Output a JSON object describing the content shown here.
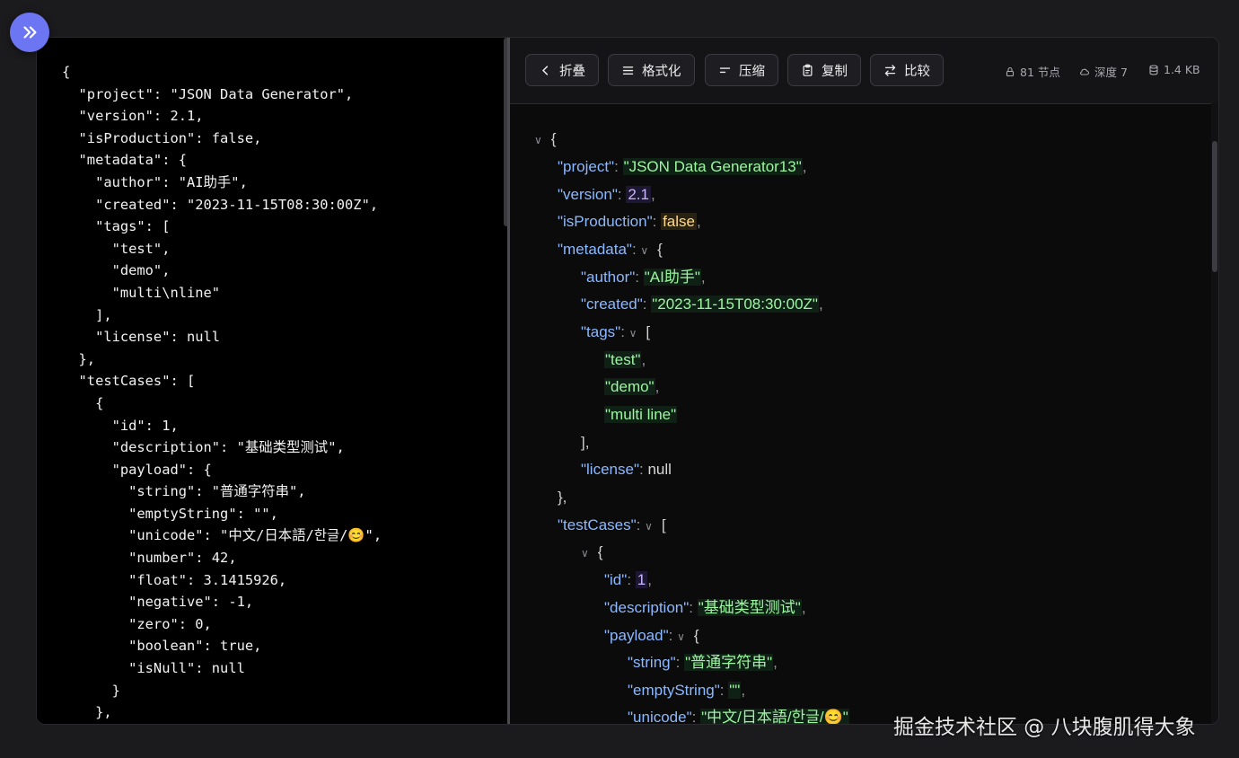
{
  "toolbar": {
    "collapse_label": "折叠",
    "format_label": "格式化",
    "compress_label": "压缩",
    "copy_label": "复制",
    "compare_label": "比较"
  },
  "stats": {
    "nodes": "81 节点",
    "depth": "深度 7",
    "size": "1.4 KB"
  },
  "raw_json": "{\n  \"project\": \"JSON Data Generator\",\n  \"version\": 2.1,\n  \"isProduction\": false,\n  \"metadata\": {\n    \"author\": \"AI助手\",\n    \"created\": \"2023-11-15T08:30:00Z\",\n    \"tags\": [\n      \"test\",\n      \"demo\",\n      \"multi\\nline\"\n    ],\n    \"license\": null\n  },\n  \"testCases\": [\n    {\n      \"id\": 1,\n      \"description\": \"基础类型测试\",\n      \"payload\": {\n        \"string\": \"普通字符串\",\n        \"emptyString\": \"\",\n        \"unicode\": \"中文/日本語/한글/😊\",\n        \"number\": 42,\n        \"float\": 3.1415926,\n        \"negative\": -1,\n        \"zero\": 0,\n        \"boolean\": true,\n        \"isNull\": null\n      }\n    },",
  "tree": {
    "open_brace": "{",
    "project_key": "\"project\"",
    "project_val": "\"JSON Data Generator13\"",
    "version_key": "\"version\"",
    "version_val": "2.1",
    "isProduction_key": "\"isProduction\"",
    "isProduction_val": "false",
    "metadata_key": "\"metadata\"",
    "author_key": "\"author\"",
    "author_val": "\"AI助手\"",
    "created_key": "\"created\"",
    "created_val": "\"2023-11-15T08:30:00Z\"",
    "tags_key": "\"tags\"",
    "tag_test": "\"test\"",
    "tag_demo": "\"demo\"",
    "tag_multi": "\"multi line\"",
    "license_key": "\"license\"",
    "license_val": "null",
    "testCases_key": "\"testCases\"",
    "id_key": "\"id\"",
    "id_val": "1",
    "description_key": "\"description\"",
    "description_val": "\"基础类型测试\"",
    "payload_key": "\"payload\"",
    "string_key": "\"string\"",
    "string_val": "\"普通字符串\"",
    "emptyString_key": "\"emptyString\"",
    "emptyString_val": "\"\"",
    "unicode_key": "\"unicode\"",
    "unicode_val": "\"中文/日本語/한글/😊\""
  },
  "watermark": "掘金技术社区 @ 八块腹肌得大象",
  "colors": {
    "accent": "#6d76f2",
    "key": "#8bb8ff",
    "string": "#9cf5a0",
    "number": "#c8b6ff",
    "boolean": "#ffd88a"
  }
}
